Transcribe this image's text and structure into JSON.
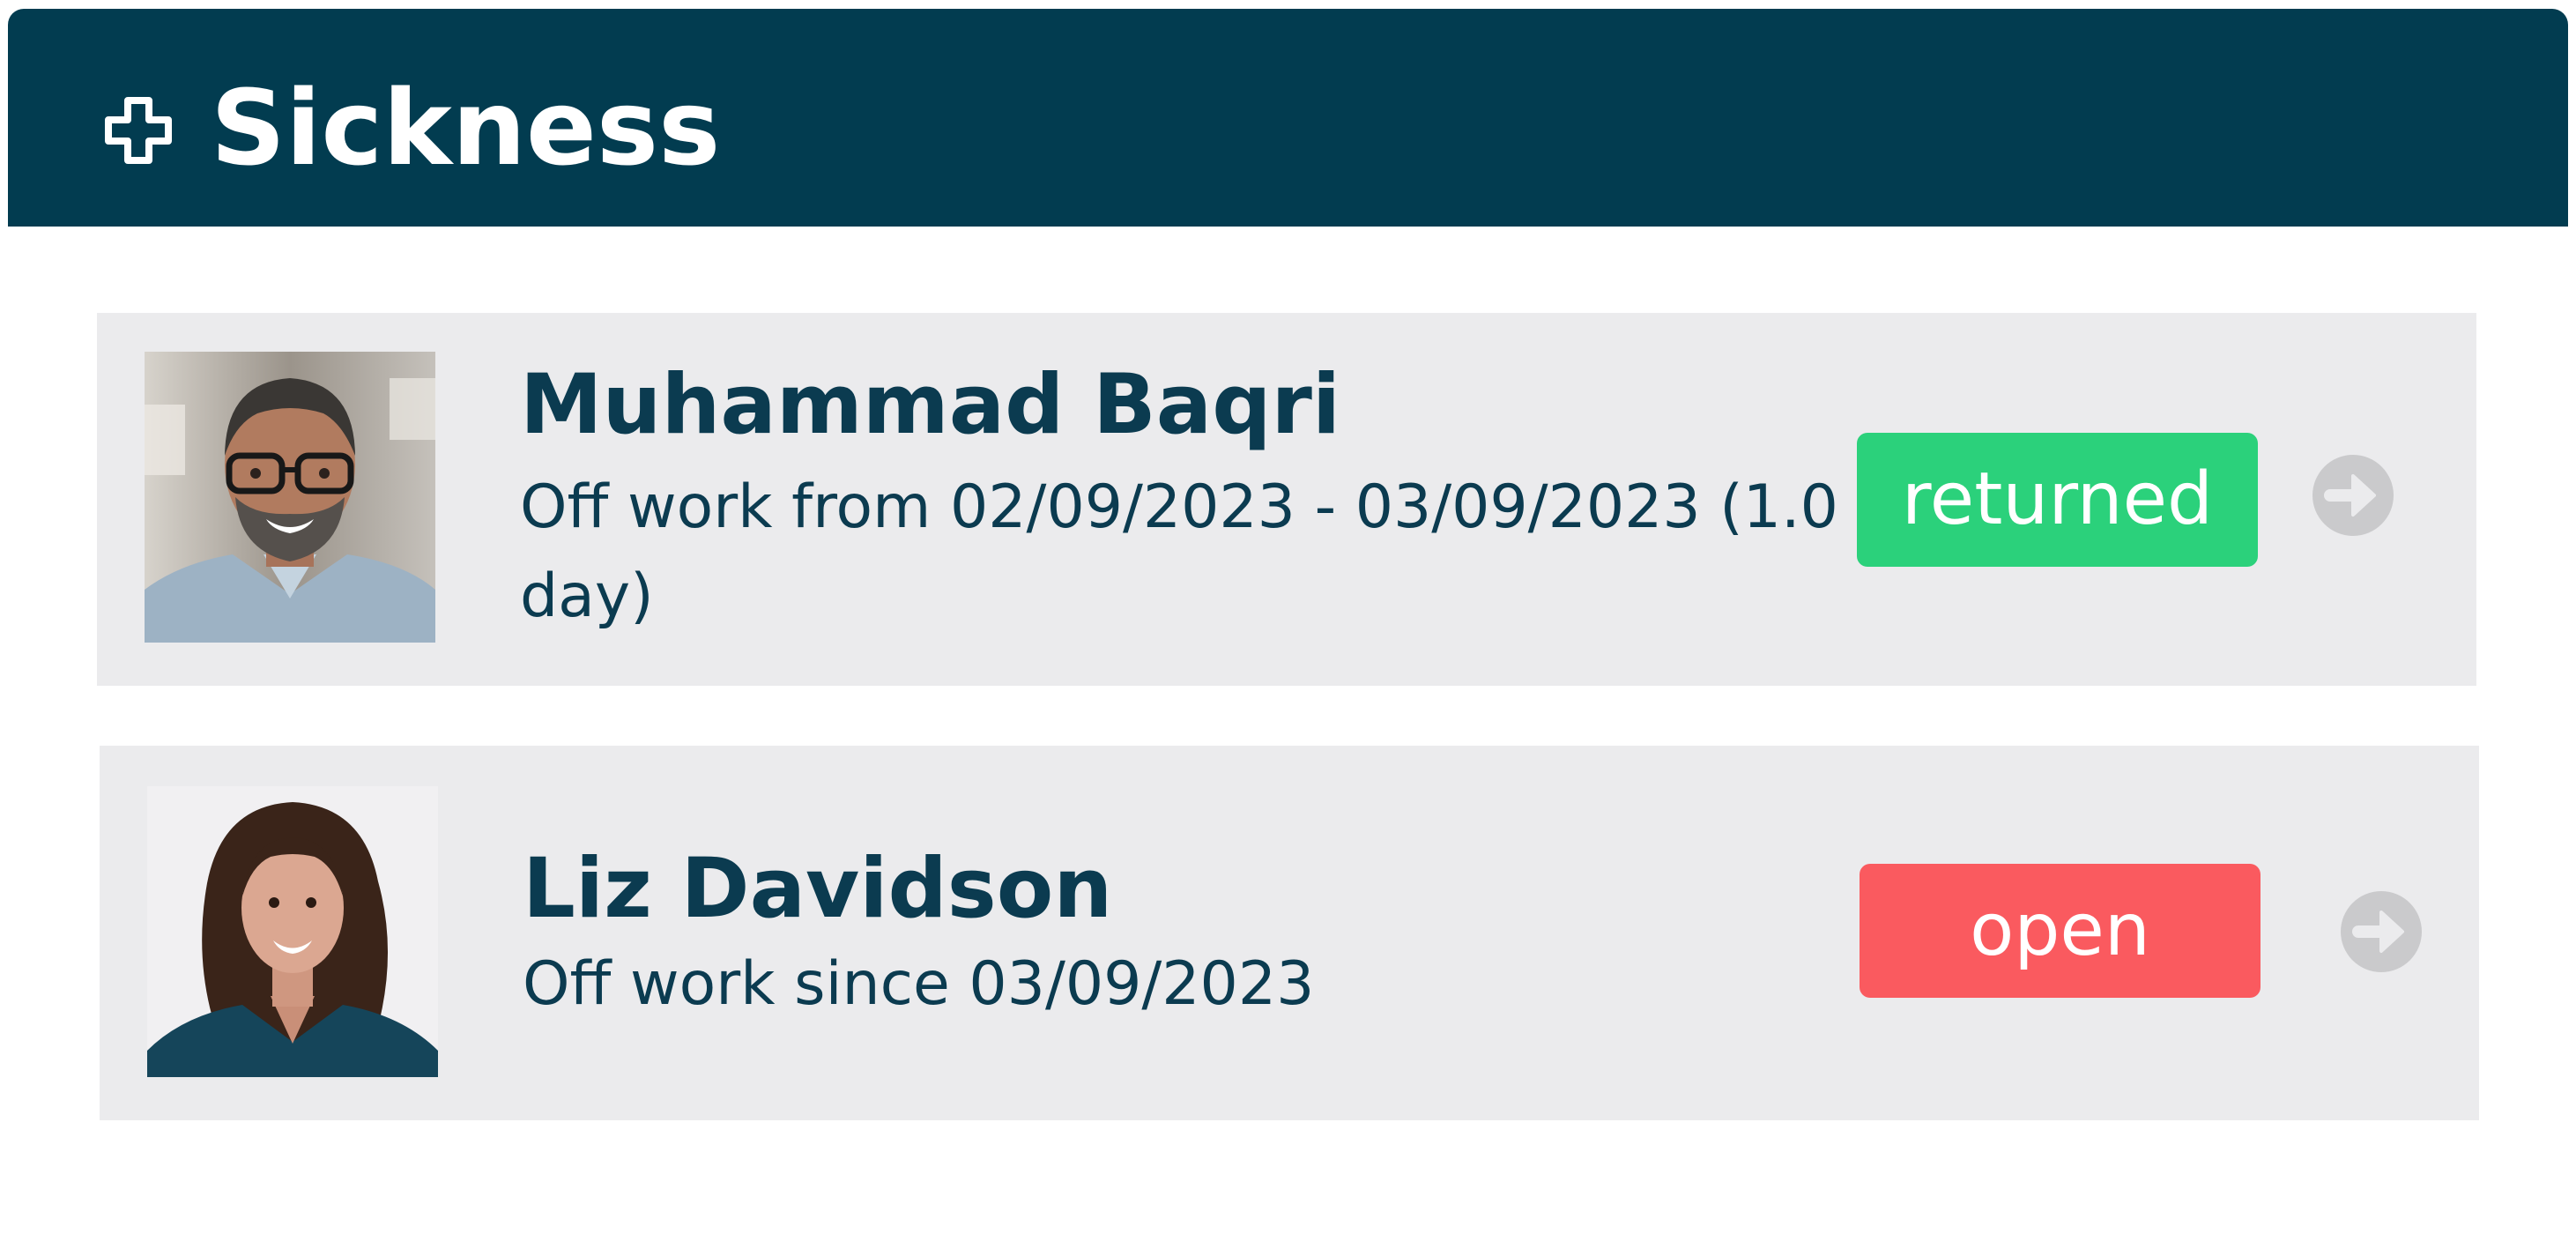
{
  "header": {
    "title": "Sickness",
    "icon": "plus-cross-icon",
    "background": "#023c50"
  },
  "cards": [
    {
      "name": "Muhammad Baqri",
      "detail": "Off work from 02/09/2023 - 03/09/2023 (1.0 day)",
      "status": "returned",
      "status_color": "#2bd17b"
    },
    {
      "name": "Liz Davidson",
      "detail": "Off work since 03/09/2023",
      "status": "open",
      "status_color": "#fa5a5f"
    }
  ],
  "icons": {
    "arrow": "arrow-right-circle-icon"
  }
}
